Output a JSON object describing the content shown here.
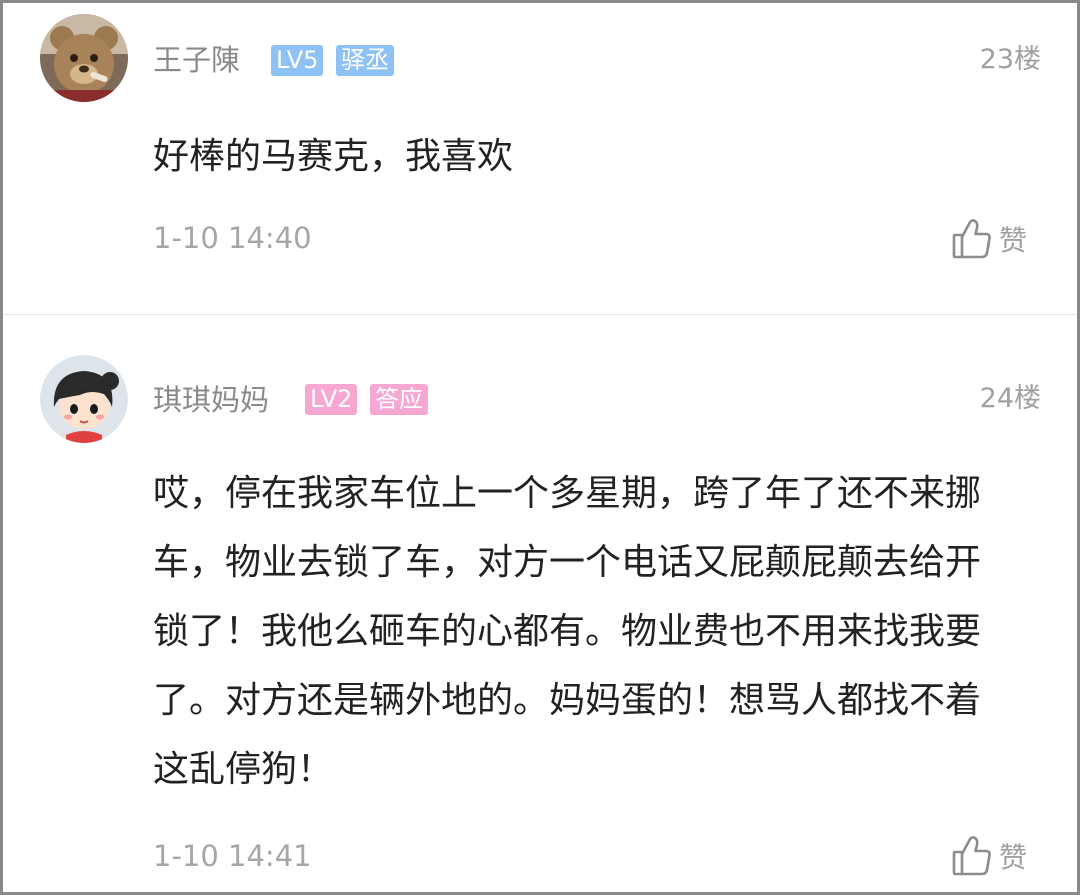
{
  "comments": [
    {
      "username": "王子陳",
      "level": "LV5",
      "title": "驿丞",
      "floor": "23楼",
      "content": "好棒的马赛克，我喜欢",
      "time": "1-10 14:40",
      "like_label": "赞",
      "badge_color": "#8ec1f4",
      "avatar_icon": "teddy-bear-avatar-icon"
    },
    {
      "username": "琪琪妈妈",
      "level": "LV2",
      "title": "答应",
      "floor": "24楼",
      "content": "哎，停在我家车位上一个多星期，跨了年了还不来挪车，物业去锁了车，对方一个电话又屁颠屁颠去给开锁了！我他么砸车的心都有。物业费也不用来找我要了。对方还是辆外地的。妈妈蛋的！想骂人都找不着这乱停狗！",
      "time": "1-10 14:41",
      "like_label": "赞",
      "badge_color": "#f6a8d3",
      "avatar_icon": "cartoon-girl-avatar-icon"
    }
  ]
}
